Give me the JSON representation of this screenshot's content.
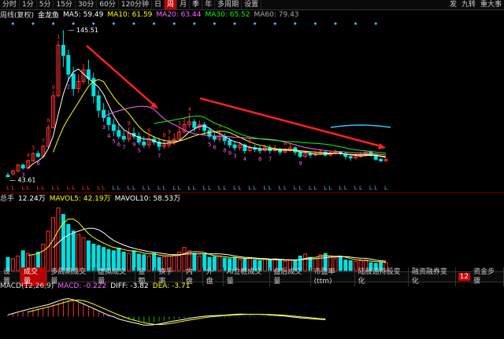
{
  "toolbar": {
    "left_items": [
      "分时",
      "1分",
      "5分",
      "15分",
      "30分",
      "60分",
      "120分钟",
      "日",
      "周",
      "月",
      "季",
      "年",
      "多周期",
      "设置"
    ],
    "active": "周",
    "right_items": [
      "发",
      "九转",
      "重大事"
    ]
  },
  "main_legend": {
    "period": "周线(复权)",
    "name": "金龙鱼",
    "ma5": "MA5: 59.49",
    "ma10": "MA10: 61.59",
    "ma20": "MA20: 63.44",
    "ma30": "MA30: 65.52",
    "ma60": "MA60: 79.43",
    "high_label": "145.51",
    "low_label": "43.61",
    "td_digits": [
      "3",
      "4",
      "5",
      "6",
      "7",
      "8",
      "9",
      "1",
      "2",
      "3",
      "4",
      "5",
      "6",
      "7",
      "8",
      "9",
      "5",
      "6",
      "7",
      "8",
      "9",
      "3",
      "4",
      "5",
      "6",
      "7",
      "8",
      "9",
      "3",
      "4",
      "5",
      "6",
      "7",
      "8",
      "9"
    ]
  },
  "volume_legend": {
    "title": "总手",
    "value": "12.24万",
    "mavol5": "MAVOL5: 42.19万",
    "mavol10": "MAVOL10: 58.53万"
  },
  "indicator_tabs": {
    "items": [
      "设置",
      "成交量",
      "多周期成交量",
      "虚拟成交量",
      "金额",
      "换手率",
      "内盘",
      "外盘",
      "AI立桩成交量",
      "盘后成交量",
      "市盈率(ttm)",
      "陆股通持股变化",
      "融资融券变化"
    ],
    "active": "成交量",
    "badge": "12",
    "badge_label": "资金步骤"
  },
  "macd_legend": {
    "title": "MACD(12,26,9)",
    "macd": "MACD: -0.222",
    "diff": "DIFF: -3.82",
    "dea": "DEA: -3.71"
  },
  "colors": {
    "up": "#ff3030",
    "down": "#00e0e0",
    "ma5": "#ffffff",
    "ma10": "#ffff00",
    "ma20": "#ff66ff",
    "ma30": "#00ff00",
    "ma60": "#aaaaaa",
    "arrow": "#ff2020",
    "label_magenta": "#ff55ff",
    "label_yellow": "#ffff00"
  },
  "chart_data": {
    "type": "candlestick",
    "price_ylim": [
      40,
      150
    ],
    "candles": [
      [
        45,
        44,
        47,
        43.61
      ],
      [
        46,
        48,
        49,
        45
      ],
      [
        48,
        52,
        53,
        47
      ],
      [
        52,
        50,
        53,
        49
      ],
      [
        50,
        55,
        56,
        49
      ],
      [
        55,
        60,
        61,
        54
      ],
      [
        60,
        58,
        62,
        57
      ],
      [
        58,
        65,
        66,
        57
      ],
      [
        65,
        78,
        80,
        64
      ],
      [
        78,
        100,
        103,
        77
      ],
      [
        100,
        135,
        138,
        99
      ],
      [
        135,
        128,
        145.51,
        120
      ],
      [
        128,
        115,
        132,
        110
      ],
      [
        115,
        105,
        120,
        100
      ],
      [
        105,
        110,
        115,
        102
      ],
      [
        110,
        118,
        122,
        108
      ],
      [
        118,
        112,
        125,
        108
      ],
      [
        112,
        100,
        116,
        95
      ],
      [
        100,
        90,
        104,
        85
      ],
      [
        90,
        85,
        95,
        82
      ],
      [
        85,
        80,
        90,
        76
      ],
      [
        80,
        76,
        84,
        72
      ],
      [
        76,
        72,
        80,
        70
      ],
      [
        72,
        70,
        76,
        68
      ],
      [
        70,
        74,
        78,
        68
      ],
      [
        74,
        72,
        78,
        70
      ],
      [
        72,
        68,
        75,
        66
      ],
      [
        68,
        66,
        72,
        64
      ],
      [
        66,
        70,
        73,
        64
      ],
      [
        70,
        68,
        72,
        66
      ],
      [
        68,
        65,
        71,
        62
      ],
      [
        65,
        66,
        70,
        63
      ],
      [
        66,
        68,
        72,
        64
      ],
      [
        68,
        70,
        74,
        66
      ],
      [
        70,
        75,
        78,
        68
      ],
      [
        75,
        80,
        85,
        74
      ],
      [
        80,
        82,
        88,
        78
      ],
      [
        82,
        78,
        84,
        75
      ],
      [
        78,
        80,
        83,
        76
      ],
      [
        80,
        76,
        82,
        73
      ],
      [
        76,
        72,
        78,
        70
      ],
      [
        72,
        70,
        75,
        68
      ],
      [
        70,
        72,
        76,
        68
      ],
      [
        72,
        69,
        74,
        66
      ],
      [
        69,
        66,
        71,
        64
      ],
      [
        66,
        64,
        68,
        62
      ],
      [
        64,
        66,
        68,
        62
      ],
      [
        66,
        62,
        67,
        60
      ],
      [
        62,
        64,
        66,
        61
      ],
      [
        64,
        63,
        66,
        61
      ],
      [
        63,
        62,
        65,
        60
      ],
      [
        62,
        64,
        66,
        61
      ],
      [
        64,
        62,
        66,
        60
      ],
      [
        62,
        63,
        66,
        61
      ],
      [
        63,
        61,
        64,
        59
      ],
      [
        61,
        62,
        64,
        60
      ],
      [
        62,
        64,
        67,
        61
      ],
      [
        64,
        61,
        65,
        59
      ],
      [
        61,
        58,
        62,
        57
      ],
      [
        58,
        60,
        62,
        57
      ],
      [
        60,
        59,
        61,
        57
      ],
      [
        59,
        60,
        62,
        58
      ],
      [
        60,
        61,
        63,
        59
      ],
      [
        61,
        59,
        62,
        58
      ],
      [
        59,
        60,
        62,
        58
      ],
      [
        60,
        61,
        63,
        59
      ],
      [
        61,
        60,
        62,
        59
      ],
      [
        60,
        58,
        61,
        56
      ],
      [
        58,
        57,
        59,
        55
      ],
      [
        57,
        58,
        60,
        56
      ],
      [
        58,
        59,
        61,
        57
      ],
      [
        59,
        61,
        62,
        58
      ],
      [
        61,
        59,
        62,
        58
      ],
      [
        59,
        56,
        60,
        55
      ],
      [
        56,
        55,
        57,
        54
      ],
      [
        55,
        56,
        57,
        54
      ]
    ],
    "volumes": [
      20,
      18,
      22,
      30,
      26,
      24,
      28,
      40,
      60,
      80,
      95,
      85,
      70,
      60,
      55,
      50,
      45,
      40,
      38,
      35,
      32,
      30,
      34,
      28,
      26,
      30,
      25,
      24,
      22,
      26,
      20,
      21,
      22,
      24,
      28,
      35,
      30,
      26,
      22,
      24,
      20,
      21,
      22,
      19,
      18,
      20,
      17,
      18,
      19,
      16,
      15,
      17,
      16,
      18,
      15,
      14,
      16,
      15,
      22,
      25,
      20,
      18,
      24,
      26,
      22,
      18,
      20,
      16,
      15,
      14,
      15,
      16,
      12,
      11,
      12,
      12
    ],
    "mavol_ylim": [
      0,
      100
    ],
    "macd_hist": [
      1,
      1.5,
      2,
      2.5,
      3,
      3.5,
      4,
      4.5,
      5,
      6,
      7,
      8,
      8.5,
      8,
      7,
      6,
      5,
      4,
      3,
      2,
      1,
      0.5,
      -0.5,
      -1,
      -1.5,
      -2,
      -2.5,
      -3,
      -3,
      -2.8,
      -2.5,
      -2,
      -1.5,
      -1.2,
      -1,
      -0.8,
      -0.5,
      -0.3,
      -0.2,
      -0.1,
      -0.2,
      -0.3,
      -0.4,
      -0.5,
      -0.4,
      -0.3,
      -0.2,
      -0.3,
      -0.4,
      -0.3,
      -0.2,
      -0.2,
      -0.3,
      -0.2,
      -0.2,
      -0.1,
      -0.2,
      -0.2,
      -0.3,
      -0.2,
      -0.2,
      -0.2,
      -0.2,
      -0.22
    ],
    "macd_ylim": [
      -10,
      12
    ]
  }
}
